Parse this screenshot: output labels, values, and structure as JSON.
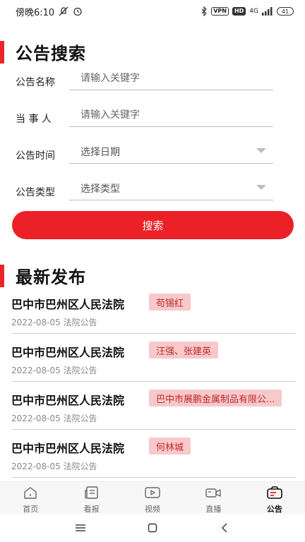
{
  "status_bar": {
    "time": "傍晚6:10",
    "vpn": "VPN",
    "hd": "HD",
    "network": "4G",
    "battery": "41"
  },
  "search_section": {
    "title": "公告搜索",
    "fields": [
      {
        "label": "公告名称",
        "placeholder": "请输入关键字"
      },
      {
        "label": "当 事 人",
        "placeholder": "请输入关键字"
      },
      {
        "label": "公告时间",
        "value": "选择日期"
      },
      {
        "label": "公告类型",
        "value": "选择类型"
      }
    ],
    "search_button": "搜索"
  },
  "latest_section": {
    "title": "最新发布",
    "items": [
      {
        "court": "巴中市巴州区人民法院",
        "party": "苟锡红",
        "date": "2022-08-05",
        "type": "法院公告"
      },
      {
        "court": "巴中市巴州区人民法院",
        "party": "汪强、张建英",
        "date": "2022-08-05",
        "type": "法院公告"
      },
      {
        "court": "巴中市巴州区人民法院",
        "party": "巴中市展鹏金属制品有限公...",
        "date": "2022-08-05",
        "type": "法院公告"
      },
      {
        "court": "巴中市巴州区人民法院",
        "party": "何林城",
        "date": "2022-08-05",
        "type": "法院公告"
      }
    ]
  },
  "tab_bar": {
    "tabs": [
      {
        "label": "首页",
        "icon": "home-icon"
      },
      {
        "label": "看报",
        "icon": "newspaper-icon"
      },
      {
        "label": "视频",
        "icon": "video-icon"
      },
      {
        "label": "直播",
        "icon": "live-icon"
      },
      {
        "label": "公告",
        "icon": "notice-icon"
      }
    ],
    "active_index": 4
  },
  "colors": {
    "accent": "#ec2027",
    "tag_bg": "#f7c9ca"
  }
}
